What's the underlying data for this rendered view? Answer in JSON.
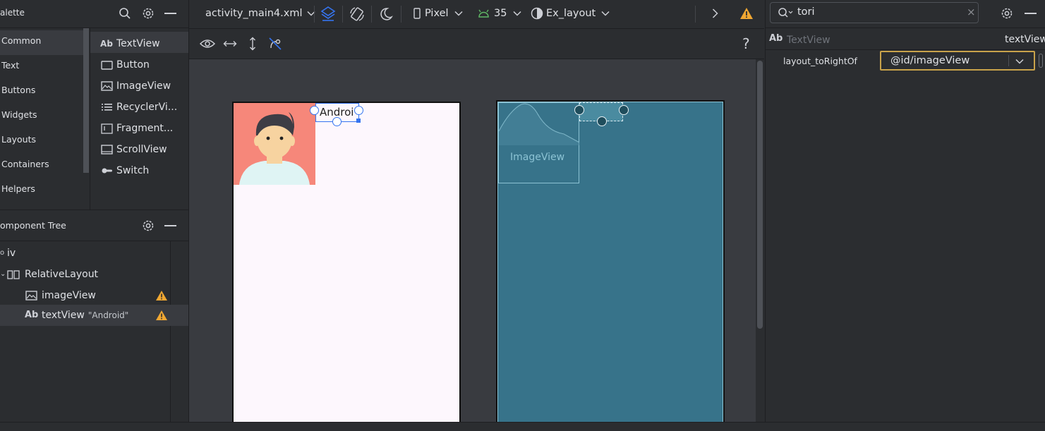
{
  "palette": {
    "title": "alette",
    "categories": [
      "Common",
      "Text",
      "Buttons",
      "Widgets",
      "Layouts",
      "Containers",
      "Helpers"
    ],
    "items": [
      {
        "label": "TextView",
        "icon": "textview-icon"
      },
      {
        "label": "Button",
        "icon": "button-icon"
      },
      {
        "label": "ImageView",
        "icon": "imageview-icon"
      },
      {
        "label": "RecyclerVi...",
        "icon": "recyclerview-icon"
      },
      {
        "label": "Fragment...",
        "icon": "fragment-icon"
      },
      {
        "label": "ScrollView",
        "icon": "scrollview-icon"
      },
      {
        "label": "Switch",
        "icon": "switch-icon"
      }
    ],
    "ab_glyph": "Ab"
  },
  "tree": {
    "title": "omponent Tree",
    "root": "iv",
    "layout": "RelativeLayout",
    "image_view": "imageView",
    "text_view": "textView",
    "text_view_value": "\"Android\"",
    "ab_glyph": "Ab"
  },
  "toolbar": {
    "file": "activity_main4.xml",
    "device": "Pixel",
    "api": "35",
    "theme": "Ex_layout"
  },
  "canvas": {
    "design_text": "Androi",
    "blueprint_label": "ImageView"
  },
  "attrs": {
    "search_value": "tori",
    "component_type": "TextView",
    "component_id": "textView",
    "ab_glyph": "Ab",
    "attr_name": "layout_toRightOf",
    "attr_value": "@id/imageView"
  },
  "colors": {
    "accent": "#3574f0",
    "warning": "#f0a732",
    "blueprint": "#37738a",
    "avatar_bg": "#f6877a",
    "highlight_border": "#c8a24a"
  }
}
